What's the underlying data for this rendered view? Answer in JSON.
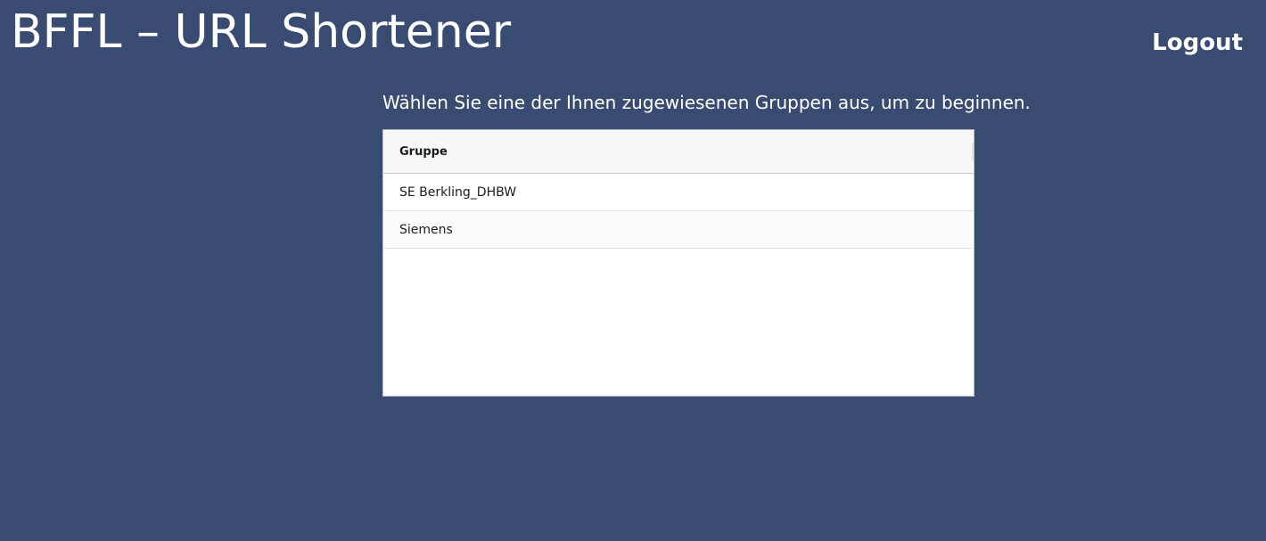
{
  "header": {
    "title": "BFFL – URL Shortener",
    "logout_label": "Logout"
  },
  "main": {
    "instruction": "Wählen Sie eine der Ihnen zugewiesenen Gruppen aus, um zu beginnen.",
    "table": {
      "column_header": "Gruppe",
      "rows": [
        {
          "name": "SE Berkling_DHBW"
        },
        {
          "name": "Siemens"
        }
      ]
    }
  },
  "colors": {
    "background": "#3a4b72",
    "text": "#ffffff",
    "table_background": "#ffffff"
  }
}
